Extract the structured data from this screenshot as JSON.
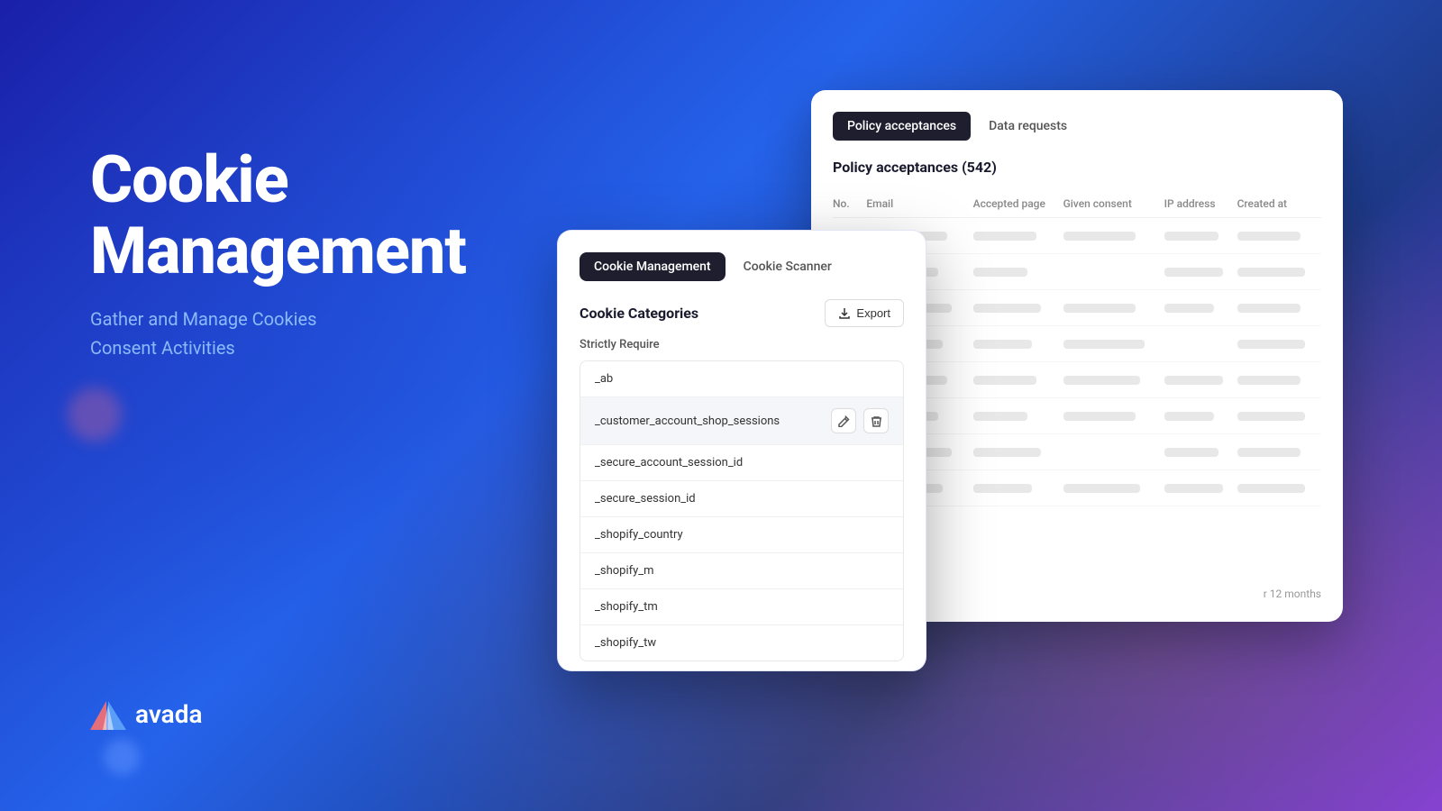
{
  "background": {
    "gradient_start": "#1a1fa8",
    "gradient_end": "#2563eb"
  },
  "left_panel": {
    "title_line1": "Cookie",
    "title_line2": "Management",
    "subtitle_line1": "Gather and Manage Cookies",
    "subtitle_line2": "Consent Activities"
  },
  "logo": {
    "text": "avada"
  },
  "policy_card": {
    "tab_active": "Policy acceptances",
    "tab_inactive": "Data requests",
    "section_title": "Policy acceptances (542)",
    "columns": [
      "No.",
      "Email",
      "Accepted page",
      "Given consent",
      "IP address",
      "Created at"
    ],
    "skeleton_rows": [
      {
        "col1_w": 40,
        "col2_w": 90,
        "col3_w": 70,
        "col4_w": 80,
        "col5_w": 60,
        "col6_w": 70
      },
      {
        "col1_w": 40,
        "col2_w": 80,
        "col3_w": 60,
        "col4_w": 85,
        "col5_w": 65,
        "col6_w": 75
      },
      {
        "col1_w": 40,
        "col2_w": 95,
        "col3_w": 75,
        "col4_w": 80,
        "col5_w": 55,
        "col6_w": 70
      },
      {
        "col1_w": 40,
        "col2_w": 85,
        "col3_w": 65,
        "col4_w": 90,
        "col5_w": 60,
        "col6_w": 75
      },
      {
        "col1_w": 40,
        "col2_w": 90,
        "col3_w": 70,
        "col4_w": 85,
        "col5_w": 65,
        "col6_w": 70
      },
      {
        "col1_w": 40,
        "col2_w": 80,
        "col3_w": 60,
        "col4_w": 80,
        "col5_w": 55,
        "col6_w": 75
      },
      {
        "col1_w": 40,
        "col2_w": 95,
        "col3_w": 75,
        "col4_w": 90,
        "col5_w": 60,
        "col6_w": 70
      },
      {
        "col1_w": 40,
        "col2_w": 85,
        "col3_w": 65,
        "col4_w": 85,
        "col5_w": 65,
        "col6_w": 75
      }
    ],
    "footer_text": "r 12 months"
  },
  "cookie_card": {
    "tab_active": "Cookie Management",
    "tab_inactive": "Cookie Scanner",
    "section_title": "Cookie Categories",
    "export_label": "Export",
    "category_label": "Strictly Require",
    "cookies": [
      {
        "name": "_ab",
        "highlighted": false
      },
      {
        "name": "_customer_account_shop_sessions",
        "highlighted": true
      },
      {
        "name": "_secure_account_session_id",
        "highlighted": false
      },
      {
        "name": "_secure_session_id",
        "highlighted": false
      },
      {
        "name": "_shopify_country",
        "highlighted": false
      },
      {
        "name": "_shopify_m",
        "highlighted": false
      },
      {
        "name": "_shopify_tm",
        "highlighted": false
      },
      {
        "name": "_shopify_tw",
        "highlighted": false
      }
    ],
    "edit_icon": "✎",
    "delete_icon": "🗑"
  }
}
